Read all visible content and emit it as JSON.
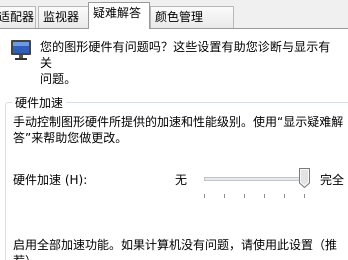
{
  "tabs": [
    {
      "label": "适配器",
      "active": false
    },
    {
      "label": "监视器",
      "active": false
    },
    {
      "label": "疑难解答",
      "active": true
    },
    {
      "label": "颜色管理",
      "active": false
    }
  ],
  "intro_text": "您的图形硬件有问题吗？这些设置有助您诊断与显示有关\n问题。",
  "group": {
    "title": "硬件加速",
    "description": "手动控制图形硬件所提供的加速和性能级别。使用“显示疑难解\n答”来帮助您做更改。",
    "slider_label": "硬件加速 (H):",
    "min_label": "无",
    "max_label": "完全",
    "slider_value_fraction": 1.0,
    "tick_count": 6,
    "recommendation": "启用全部加速功能。如果计算机没有问题，请使用此设置（推\n荐）。"
  },
  "colors": {
    "panel_bg": "#ffffff",
    "window_bg": "#f0f0f0",
    "group_border": "#d5dfe5",
    "monitor_screen": "#1f3f8f"
  },
  "icons": {
    "monitor": "monitor-icon",
    "slider_thumb": "slider-thumb"
  }
}
